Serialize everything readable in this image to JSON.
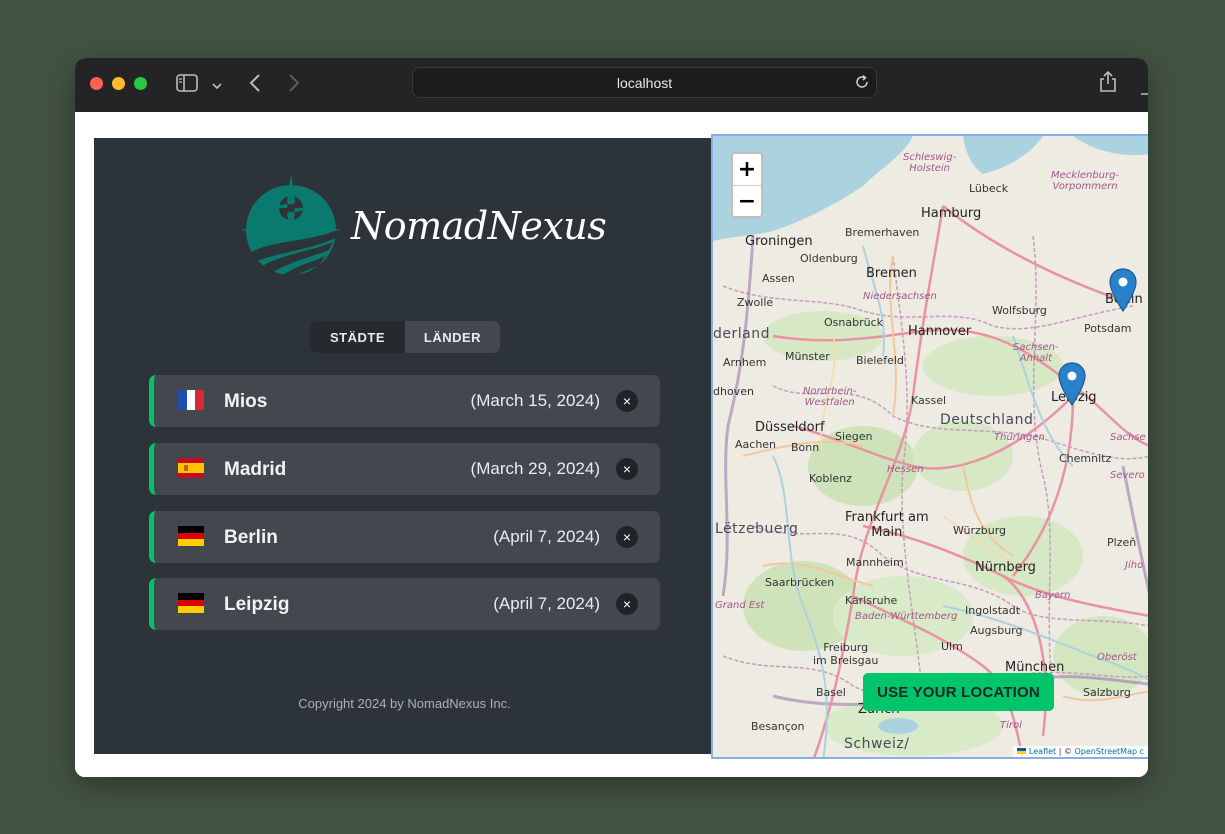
{
  "browser": {
    "url": "localhost"
  },
  "app": {
    "logo_text": "NomadNexus",
    "tabs": [
      {
        "label": "STÄDTE",
        "active": true
      },
      {
        "label": "LÄNDER",
        "active": false
      }
    ],
    "cities": [
      {
        "name": "Mios",
        "date": "(March 15, 2024)",
        "country": "France",
        "flag_icon": "flag-france-icon"
      },
      {
        "name": "Madrid",
        "date": "(March 29, 2024)",
        "country": "Spain",
        "flag_icon": "flag-spain-icon"
      },
      {
        "name": "Berlin",
        "date": "(April 7, 2024)",
        "country": "Germany",
        "flag_icon": "flag-germany-icon"
      },
      {
        "name": "Leipzig",
        "date": "(April 7, 2024)",
        "country": "Germany",
        "flag_icon": "flag-germany-icon"
      }
    ],
    "delete_label": "×",
    "copyright": "Copyright 2024 by NomadNexus Inc."
  },
  "map": {
    "zoom_in_label": "+",
    "zoom_out_label": "−",
    "use_location_label": "USE YOUR LOCATION",
    "attribution_leaflet": "Leaflet",
    "attribution_sep": " | © ",
    "attribution_osm": "OpenStreetMap c",
    "labels": {
      "schleswig": "Schleswig-\nHolstein",
      "luebeck": "Lübeck",
      "mecklenburg": "Mecklenburg-\nVorpommern",
      "hamburg": "Hamburg",
      "bremerhaven": "Bremerhaven",
      "groningen": "Groningen",
      "oldenburg": "Oldenburg",
      "bremen": "Bremen",
      "assen": "Assen",
      "niedersachsen": "Niedersachsen",
      "zwolle": "Zwolle",
      "wolfsburg": "Wolfsburg",
      "berlin": "Berlin",
      "potsdam": "Potsdam",
      "nederland": "derland",
      "osnabrueck": "Osnabrück",
      "hannover": "Hannover",
      "sachsen_anhalt": "Sachsen-\nAnhalt",
      "arnhem": "Arnhem",
      "muenster": "Münster",
      "bielefeld": "Bielefeld",
      "leipzig": "Leipzig",
      "eindhoven": "dhoven",
      "nrw": "Nordrhein-\nWestfalen",
      "kassel": "Kassel",
      "deutschland": "Deutschland",
      "duesseldorf": "Düsseldorf",
      "siegen": "Siegen",
      "thueringen": "Thüringen",
      "sachsen": "Sachse",
      "aachen": "Aachen",
      "bonn": "Bonn",
      "chemnitz": "Chemnitz",
      "hessen": "Hessen",
      "koblenz": "Koblenz",
      "severo": "Severo",
      "frankfurt": "Frankfurt am\nMain",
      "letzebuerg": "Lëtzebuerg",
      "wuerzburg": "Würzburg",
      "plzen": "Plzeň",
      "mannheim": "Mannheim",
      "nuernberg": "Nürnberg",
      "jiho": "Jiho",
      "saarbruecken": "Saarbrücken",
      "bayern": "Bayern",
      "grand_est": "Grand Est",
      "karlsruhe": "Karlsruhe",
      "bw": "Baden-Württemberg",
      "ingolstadt": "Ingolstadt",
      "augsburg": "Augsburg",
      "ulm": "Ulm",
      "freiburg": "Freiburg\nim Breisgau",
      "muenchen": "München",
      "oberoest": "Oberöst",
      "basel": "Basel",
      "zuerich": "Zürich",
      "salzburg": "Salzburg",
      "besancon": "Besançon",
      "tirol": "Tirol",
      "schweiz": "Schweiz/"
    }
  }
}
